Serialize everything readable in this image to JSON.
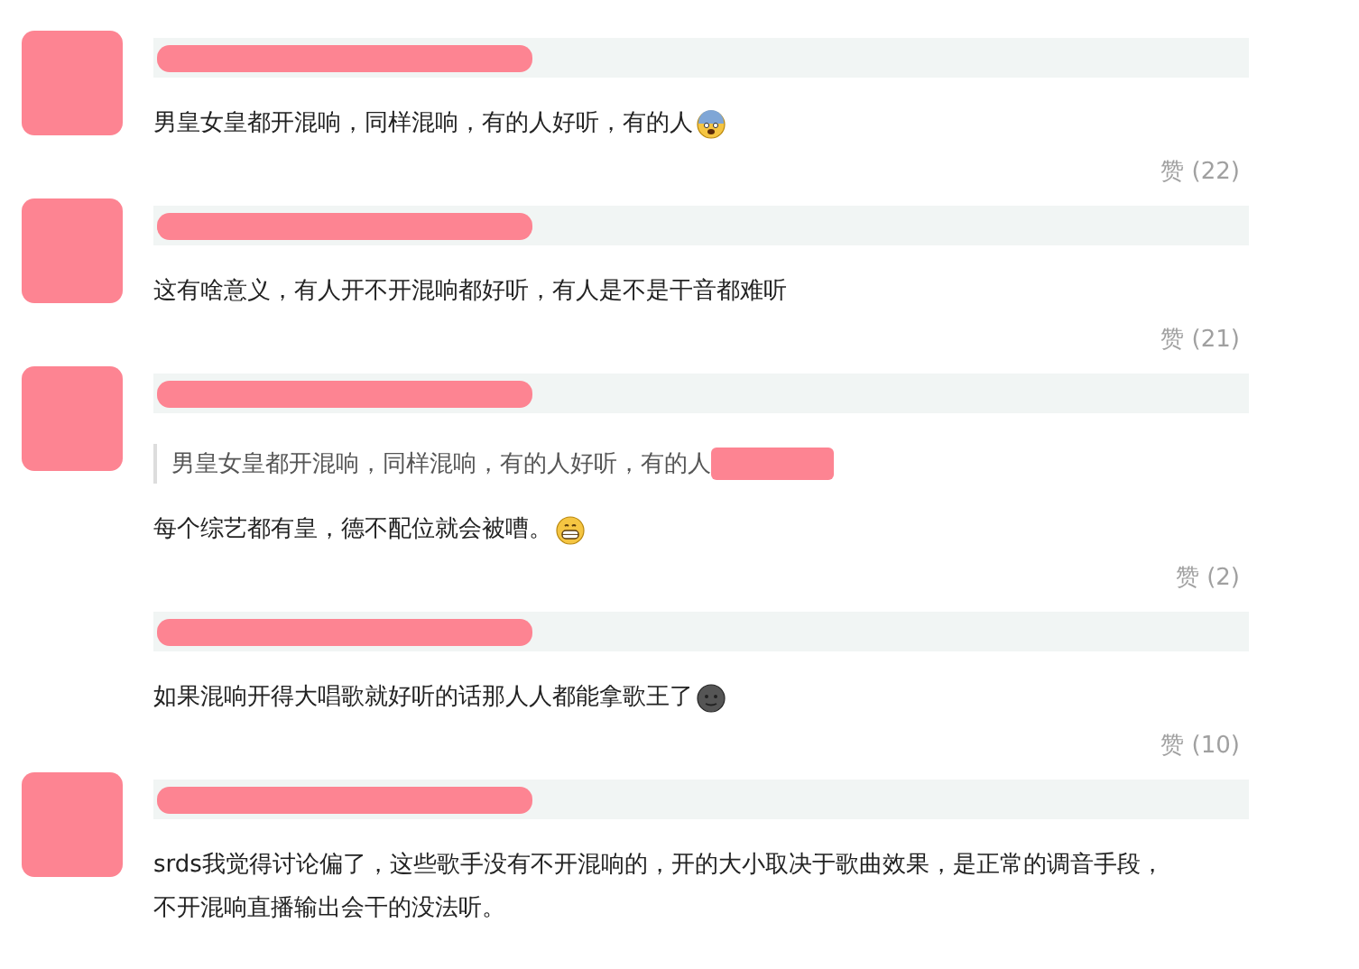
{
  "comments": [
    {
      "avatar": true,
      "text": "男皇女皇都开混响，同样混响，有的人好听，有的人",
      "kind": "fearful",
      "likes": "赞 (22)"
    },
    {
      "avatar": true,
      "text": "这有啥意义，有人开不开混响都好听，有人是不是干音都难听",
      "kind": "plain",
      "likes": "赞 (21)"
    },
    {
      "avatar": true,
      "quote": "男皇女皇都开混响，同样混响，有的人好听，有的人",
      "text": "每个综艺都有皇，德不配位就会被嘈。",
      "kind": "grin",
      "likes": "赞 (2)"
    },
    {
      "avatar": false,
      "text": "如果混响开得大唱歌就好听的话那人人都能拿歌王了",
      "kind": "dark",
      "likes": "赞 (10)"
    },
    {
      "avatar": true,
      "text": "srds我觉得讨论偏了，这些歌手没有不开混响的，开的大小取决于歌曲效果，是正常的调音手段，不开混响直播输出会干的没法听。",
      "kind": "plain"
    }
  ]
}
